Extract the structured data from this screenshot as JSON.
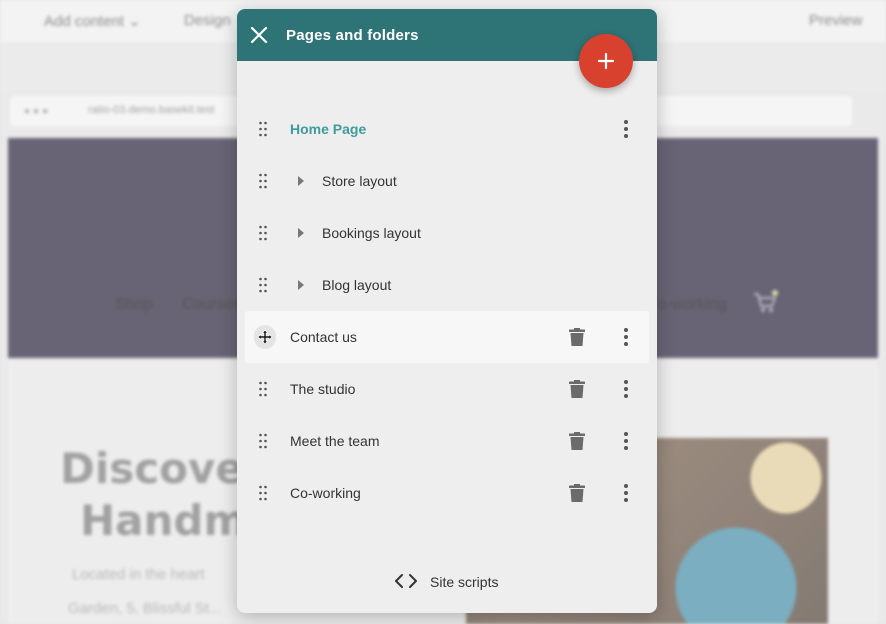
{
  "background": {
    "topbar": {
      "add_content": "Add content ⌄",
      "design": "Design",
      "preview": "Preview"
    },
    "url": "ratio-03.demo.basekit.test",
    "nav": [
      "Shop",
      "Courses",
      "Co-working"
    ],
    "heading_lines": [
      "Discover t",
      "Handmac"
    ],
    "paragraph_lines": [
      "Located in the heart",
      "Garden, 5, Blissful St..."
    ]
  },
  "panel": {
    "title": "Pages and folders",
    "header_color": "#2e7376",
    "accent_color": "#3f9b9c",
    "fab_color": "#d9412f",
    "close_icon": "close-icon",
    "add_icon": "plus-icon",
    "items": [
      {
        "label": "Home Page",
        "type": "home",
        "actions": [
          "more"
        ]
      },
      {
        "label": "Store layout",
        "type": "folder",
        "actions": []
      },
      {
        "label": "Bookings layout",
        "type": "folder",
        "actions": []
      },
      {
        "label": "Blog layout",
        "type": "folder",
        "actions": []
      },
      {
        "label": "Contact us",
        "type": "page",
        "actions": [
          "delete",
          "more"
        ],
        "hovered": true
      },
      {
        "label": "The studio",
        "type": "page",
        "actions": [
          "delete",
          "more"
        ]
      },
      {
        "label": "Meet the team",
        "type": "page",
        "actions": [
          "delete",
          "more"
        ]
      },
      {
        "label": "Co-working",
        "type": "page",
        "actions": [
          "delete",
          "more"
        ]
      }
    ],
    "footer": {
      "label": "Site scripts",
      "icon": "code-icon"
    }
  }
}
